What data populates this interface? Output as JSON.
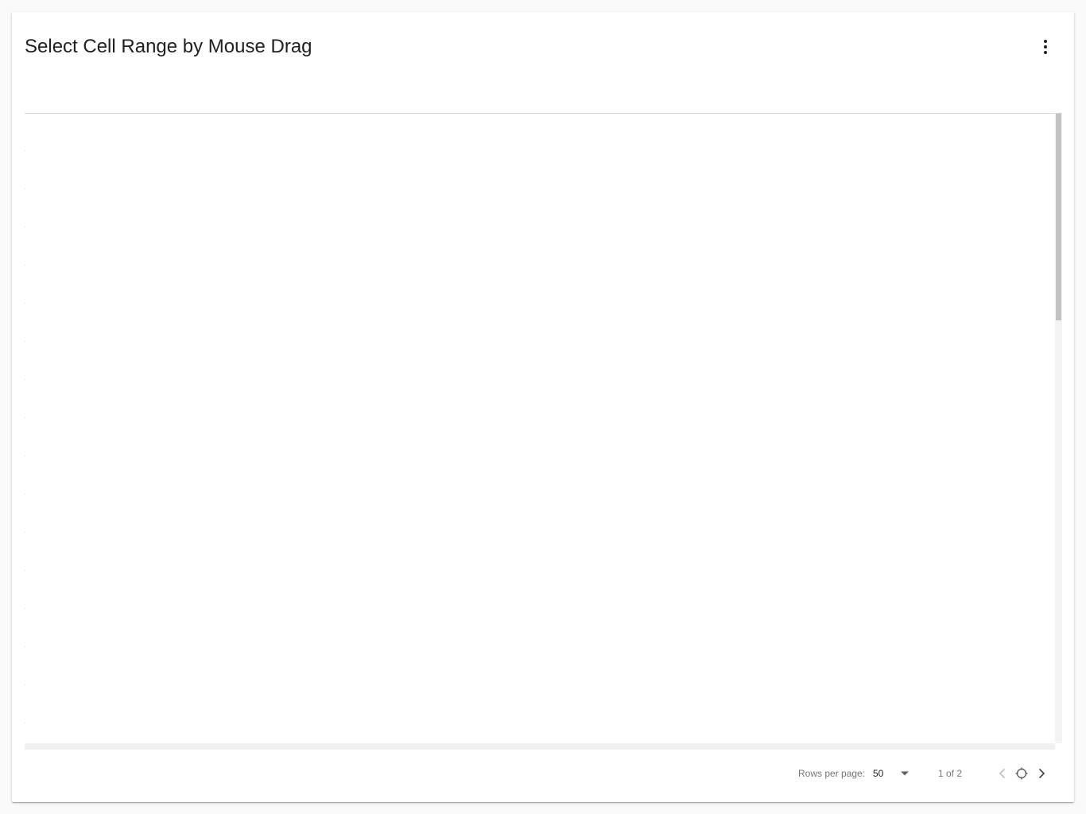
{
  "card": {
    "title": "Select Cell Range by Mouse Drag",
    "menu_icon": "more-vert-icon"
  },
  "grid": {
    "row_count_visible": 16
  },
  "pagination": {
    "rows_per_page_label": "Rows per page:",
    "rows_per_page_value": "50",
    "page_info": "1 of 2",
    "prev_icon": "chevron-left-icon",
    "refresh_icon": "refresh-icon",
    "next_icon": "chevron-right-icon"
  },
  "colors": {
    "text_primary": "#212121",
    "text_secondary": "#757575",
    "divider": "#d6d6d6",
    "scrollbar_thumb": "#c2c2c2"
  }
}
